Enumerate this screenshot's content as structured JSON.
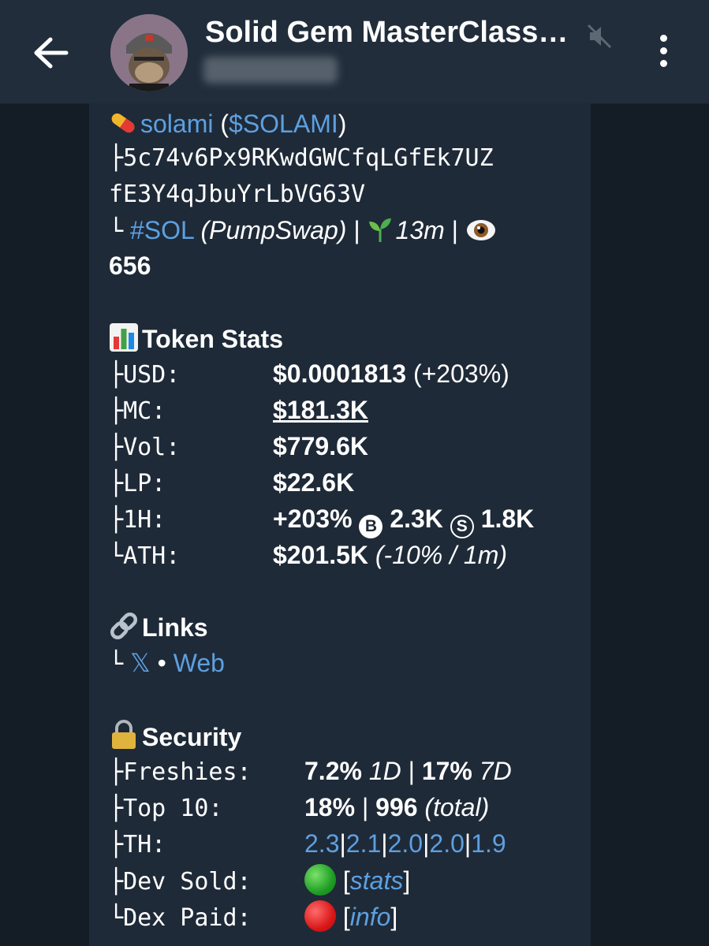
{
  "header": {
    "title": "Solid Gem MasterClass…",
    "subtitle": "subscribers"
  },
  "token": {
    "name": "solami",
    "ticker_open": " (",
    "ticker": "$SOLAMI",
    "ticker_close": ")",
    "tree_branch": "├",
    "tree_end": "└",
    "address_line1": "5c74v6Px9RKwdGWCfqLGfEk7UZ",
    "address_line2": "fE3Y4qJbuYrLbVG63V",
    "chain_tag": "#SOL",
    "dex": "(PumpSwap)",
    "sep": "|",
    "age": "13m",
    "views": "656"
  },
  "token_stats": {
    "title": "Token Stats",
    "rows": [
      {
        "prefix": "├",
        "label": "USD:",
        "value": "$0.0001813",
        "extra": "(+203%)"
      },
      {
        "prefix": "├",
        "label": "MC:",
        "value": "$181.3K",
        "extra": ""
      },
      {
        "prefix": "├",
        "label": "Vol:",
        "value": "$779.6K",
        "extra": ""
      },
      {
        "prefix": "├",
        "label": "LP:",
        "value": "$22.6K",
        "extra": ""
      }
    ],
    "h1": {
      "prefix": "├",
      "label": "1H:",
      "change": "+203%",
      "buy_glyph": "B",
      "buys": "2.3K",
      "sell_glyph": "S",
      "sells": "1.8K"
    },
    "ath": {
      "prefix": "└",
      "label": "ATH:",
      "value": "$201.5K",
      "extra": "(-10% / 1m)"
    }
  },
  "links": {
    "title": "Links",
    "prefix": "└",
    "x_label": "𝕏",
    "bullet": "•",
    "web_label": "Web"
  },
  "security": {
    "title": "Security",
    "freshies": {
      "prefix": "├",
      "label": "Freshies:",
      "v1": "7.2%",
      "p1": "1D",
      "sep": "|",
      "v2": "17%",
      "p2": "7D"
    },
    "top10": {
      "prefix": "├",
      "label": "Top 10:",
      "v1": "18%",
      "sep": "|",
      "v2": "996",
      "note": "(total)"
    },
    "th": {
      "prefix": "├",
      "label": "TH:",
      "values": [
        "2.3",
        "2.1",
        "2.0",
        "2.0",
        "1.9"
      ],
      "sep": "|"
    },
    "dev_sold": {
      "prefix": "├",
      "label": "Dev Sold:",
      "status_color": "#1f9d25",
      "open": "[",
      "link": "stats",
      "close": "]"
    },
    "dex_paid": {
      "prefix": "└",
      "label": "Dex Paid:",
      "status_color": "#d91818",
      "open": "[",
      "link": "info",
      "close": "]"
    }
  },
  "colors": {
    "link": "#5da0e0",
    "background": "#141c26",
    "bubble": "#1f2a38",
    "header": "#212d3b"
  }
}
